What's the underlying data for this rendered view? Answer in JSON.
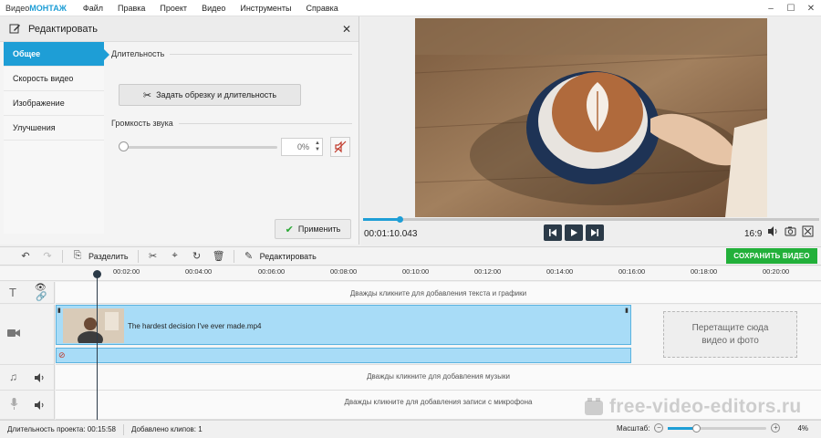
{
  "app": {
    "logo_part1": "Видео",
    "logo_part2": "МОНТАЖ",
    "menu": [
      "Файл",
      "Правка",
      "Проект",
      "Видео",
      "Инструменты",
      "Справка"
    ]
  },
  "edit_panel": {
    "title": "Редактировать",
    "tabs": [
      "Общее",
      "Скорость видео",
      "Изображение",
      "Улучшения"
    ],
    "active_tab": "Общее",
    "duration_label": "Длительность",
    "trim_button": "Задать обрезку и длительность",
    "volume_label": "Громкость звука",
    "volume_value": "0%",
    "volume_level": 0,
    "apply_button": "Применить"
  },
  "player": {
    "timecode": "00:01:10.043",
    "aspect_ratio": "16:9",
    "progress": 0.08
  },
  "toolbar": {
    "split_label": "Разделить",
    "edit_label": "Редактировать",
    "save_label": "СОХРАНИТЬ ВИДЕО"
  },
  "ruler": {
    "ticks": [
      "00:02:00",
      "00:04:00",
      "00:06:00",
      "00:08:00",
      "00:10:00",
      "00:12:00",
      "00:14:00",
      "00:16:00",
      "00:18:00",
      "00:20:00"
    ]
  },
  "timeline": {
    "text_hint": "Дважды кликните для добавления текста и графики",
    "clip_name": "The hardest decision I've ever made.mp4",
    "drop_text_line1": "Перетащите сюда",
    "drop_text_line2": "видео и фото",
    "music_hint": "Дважды кликните для добавления музыки",
    "mic_hint": "Дважды кликните для добавления записи с микрофона"
  },
  "status": {
    "duration_label": "Длительность проекта:",
    "duration_value": "00:15:58",
    "clips_label": "Добавлено клипов:",
    "clips_value": "1",
    "zoom_label": "Масштаб:",
    "zoom_value": "4%",
    "zoom_level": 0.28
  },
  "watermark": "free-video-editors.ru",
  "colors": {
    "accent": "#1e9ed6",
    "save_green": "#22b03a",
    "clip_fill": "#a8dcf7"
  }
}
